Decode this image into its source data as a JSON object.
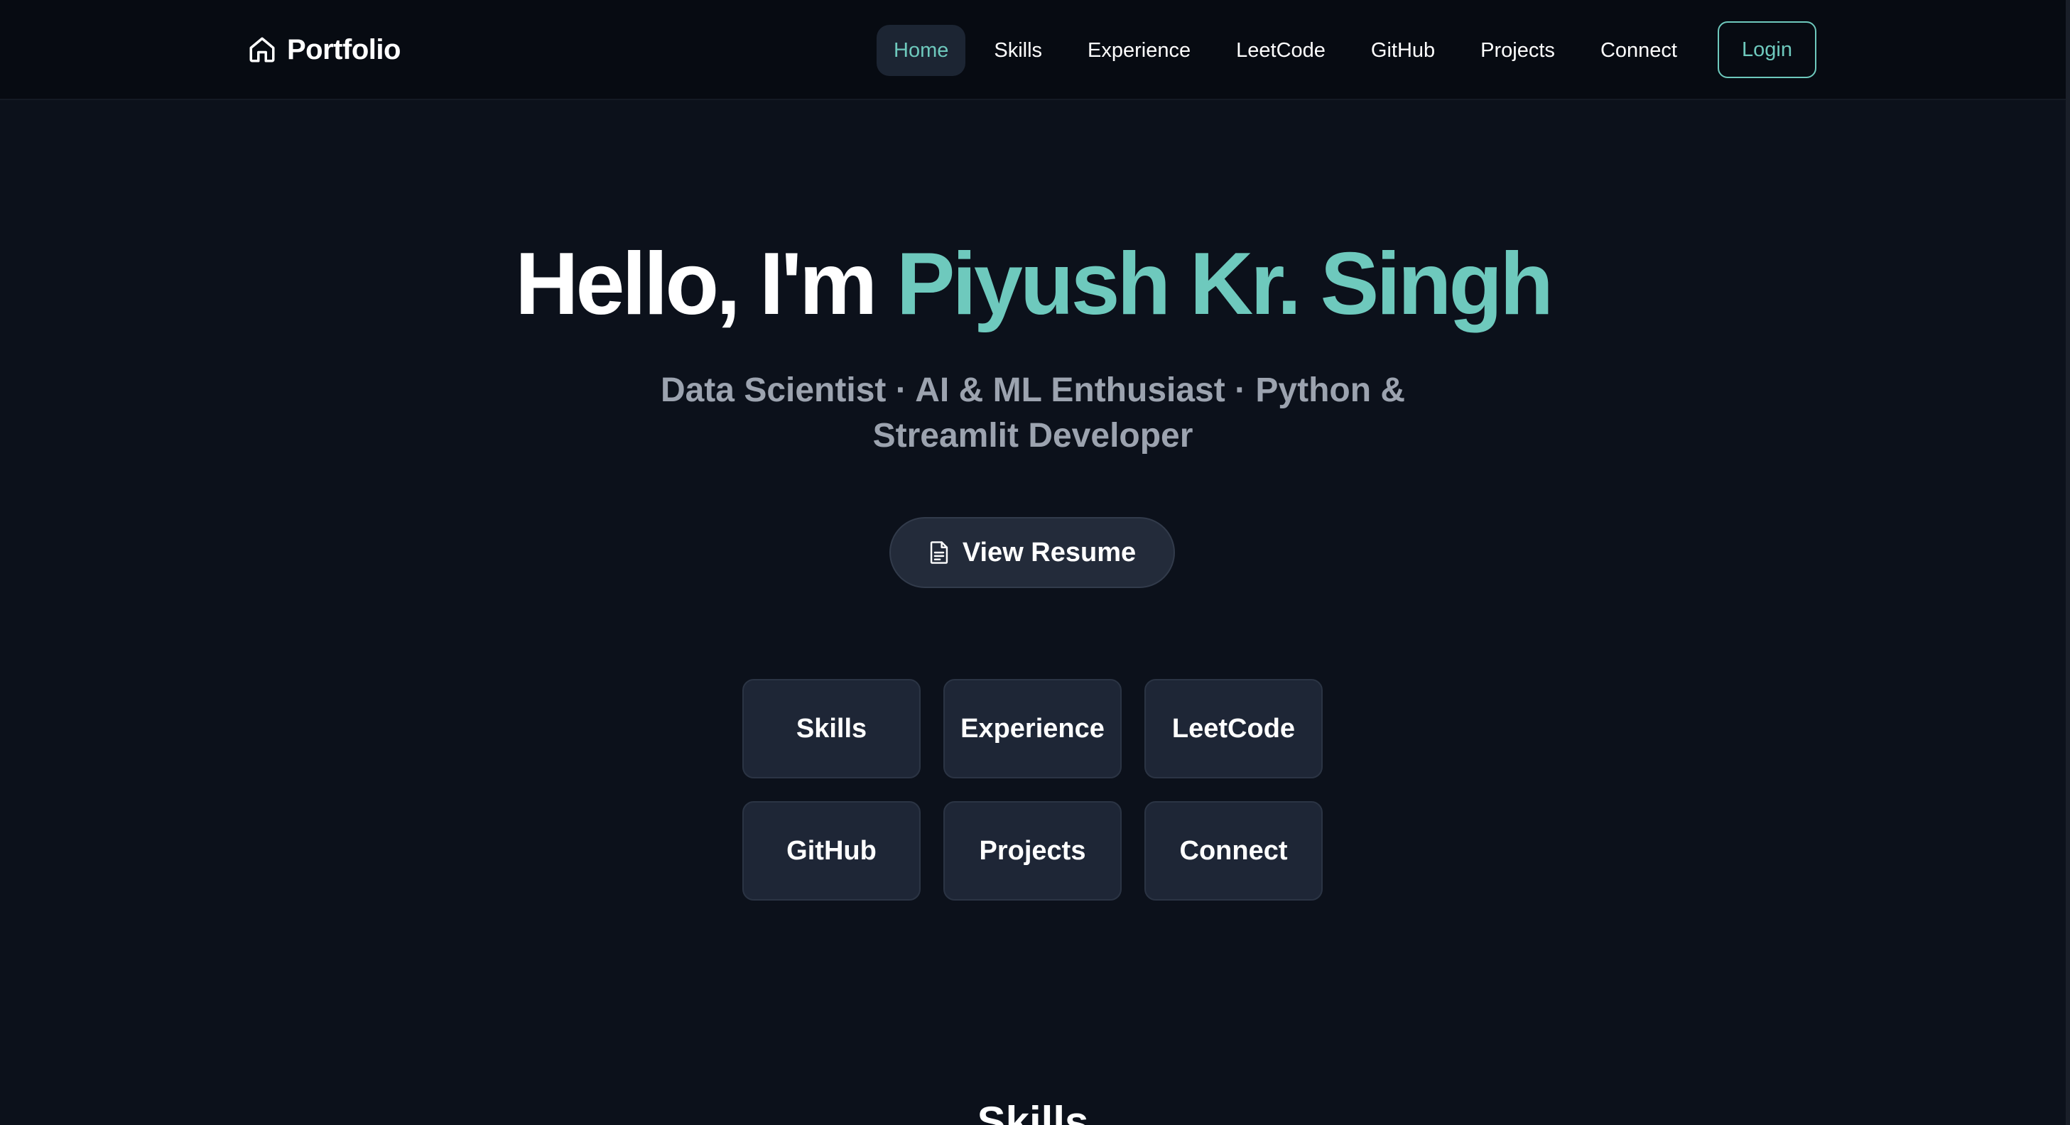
{
  "navbar": {
    "brand_label": "Portfolio",
    "brand_icon": "home-icon",
    "items": [
      {
        "label": "Home",
        "active": true
      },
      {
        "label": "Skills",
        "active": false
      },
      {
        "label": "Experience",
        "active": false
      },
      {
        "label": "LeetCode",
        "active": false
      },
      {
        "label": "GitHub",
        "active": false
      },
      {
        "label": "Projects",
        "active": false
      },
      {
        "label": "Connect",
        "active": false
      }
    ],
    "login_label": "Login"
  },
  "hero": {
    "greeting": "Hello, I'm",
    "name": "Piyush Kr. Singh",
    "subtitle": "Data Scientist · AI & ML Enthusiast · Python & Streamlit Developer",
    "resume_label": "View Resume",
    "resume_icon": "document-icon"
  },
  "tiles": [
    {
      "label": "Skills"
    },
    {
      "label": "Experience"
    },
    {
      "label": "LeetCode"
    },
    {
      "label": "GitHub"
    },
    {
      "label": "Projects"
    },
    {
      "label": "Connect"
    }
  ],
  "next_section": {
    "heading": "Skills"
  },
  "colors": {
    "background": "#0c111b",
    "navbar_bg": "#070b12",
    "accent": "#6ec9bd",
    "tile_bg": "#1e2636",
    "subtitle": "#9ca3af"
  }
}
